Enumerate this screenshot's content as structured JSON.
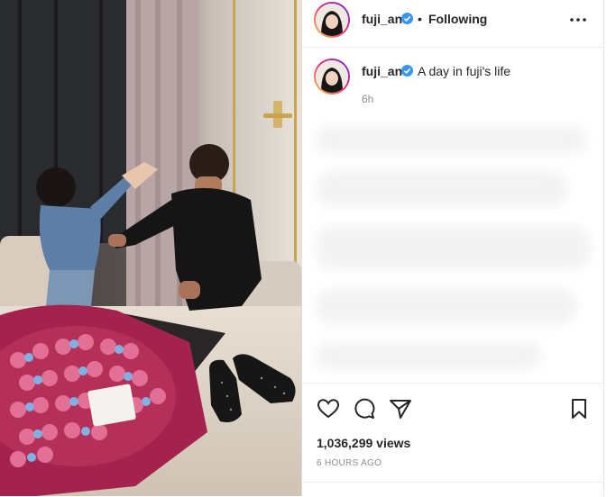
{
  "post": {
    "username": "fuji_an",
    "header_separator": "•",
    "following_label": "Following",
    "more_label": "•••",
    "caption_text": "A day in fuji's life",
    "caption_time": "6h",
    "views_text": "1,036,299 views",
    "posted_ago": "6 HOURS AGO"
  },
  "icons": {
    "like": "heart-icon",
    "comment": "comment-icon",
    "share": "paper-plane-icon",
    "save": "bookmark-icon",
    "verified": "verified-badge-icon",
    "more": "more-options-icon"
  },
  "colors": {
    "verified_blue": "#3897f0",
    "text": "#262626",
    "muted": "#8e8e8e",
    "divider": "#dbdbdb"
  }
}
